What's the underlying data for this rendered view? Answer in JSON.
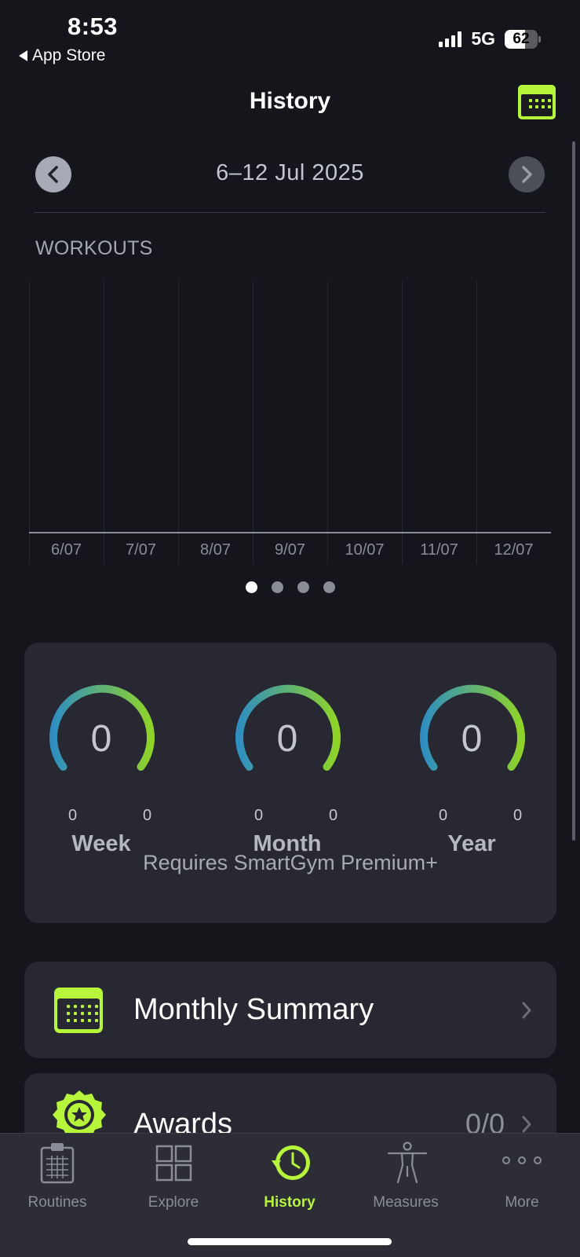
{
  "status_bar": {
    "time": "8:53",
    "back_label": "App Store",
    "network": "5G",
    "battery": "62"
  },
  "header": {
    "title": "History",
    "calendar_icon": "calendar-icon"
  },
  "week_nav": {
    "label": "6–12 Jul 2025",
    "prev_icon": "chevron-left-icon",
    "next_icon": "chevron-right-icon"
  },
  "chart_data": {
    "type": "bar",
    "title": "WORKOUTS",
    "categories": [
      "6/07",
      "7/07",
      "8/07",
      "9/07",
      "10/07",
      "11/07",
      "12/07"
    ],
    "values": [
      0,
      0,
      0,
      0,
      0,
      0,
      0
    ],
    "grid": true
  },
  "pager": {
    "count": 4,
    "active": 0
  },
  "stats": {
    "gauges": [
      {
        "value": "0",
        "min": "0",
        "max": "0",
        "label": "Week"
      },
      {
        "value": "0",
        "min": "0",
        "max": "0",
        "label": "Month"
      },
      {
        "value": "0",
        "min": "0",
        "max": "0",
        "label": "Year"
      }
    ],
    "premium_note": "Requires SmartGym Premium+"
  },
  "rows": {
    "monthly": {
      "label": "Monthly Summary",
      "icon": "calendar-icon"
    },
    "awards": {
      "label": "Awards",
      "count": "0/0",
      "icon": "award-badge-icon"
    }
  },
  "tabs": [
    {
      "label": "Routines",
      "icon": "clipboard-icon",
      "active": false
    },
    {
      "label": "Explore",
      "icon": "grid-icon",
      "active": false
    },
    {
      "label": "History",
      "icon": "clock-history-icon",
      "active": true
    },
    {
      "label": "Measures",
      "icon": "body-icon",
      "active": false
    },
    {
      "label": "More",
      "icon": "more-dots-icon",
      "active": false
    }
  ],
  "colors": {
    "accent": "#b7f53b",
    "background": "#15161c",
    "card": "#272832",
    "gauge_start": "#2f8fc0",
    "gauge_end": "#8fd32a"
  }
}
